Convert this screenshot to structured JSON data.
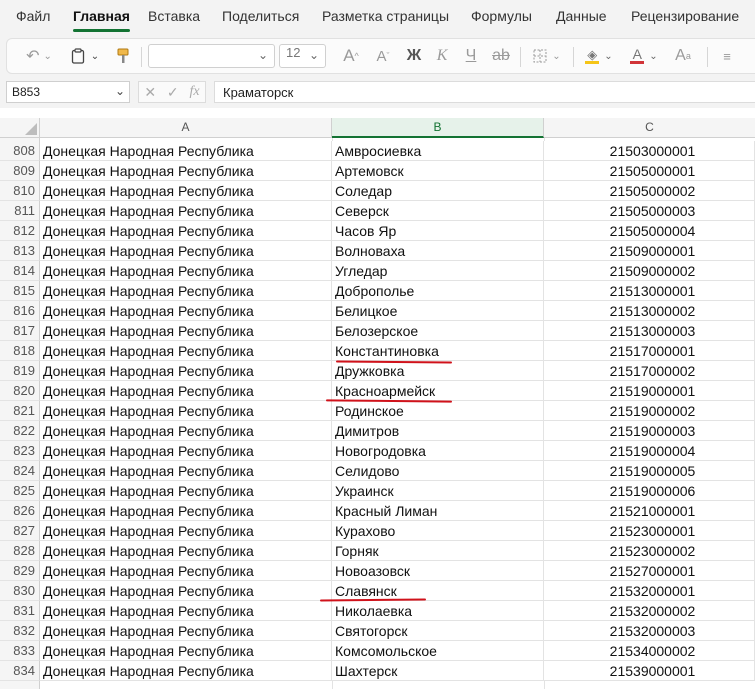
{
  "menu": {
    "tabs": [
      "Файл",
      "Главная",
      "Вставка",
      "Поделиться",
      "Разметка страницы",
      "Формулы",
      "Данные",
      "Рецензирование"
    ],
    "active_index": 1
  },
  "ribbon": {
    "font_name": "",
    "font_size": "12",
    "icons": [
      "undo-icon",
      "clipboard-icon",
      "format-painter-icon",
      "increase-font-icon",
      "decrease-font-icon",
      "bold-icon",
      "italic-icon",
      "underline-icon",
      "strikethrough-icon",
      "borders-icon",
      "fill-color-icon",
      "font-color-icon",
      "more-font-icon"
    ],
    "fill_color": "#f5c518",
    "font_color": "#d13438"
  },
  "formula_bar": {
    "name_box": "B853",
    "formula": "Краматорск"
  },
  "columns": [
    {
      "label": "A",
      "selected": false
    },
    {
      "label": "B",
      "selected": true
    },
    {
      "label": "C",
      "selected": false
    }
  ],
  "rows": [
    {
      "n": "808",
      "a": "Донецкая Народная Республика",
      "b": "Амвросиевка",
      "c": "21503000001"
    },
    {
      "n": "809",
      "a": "Донецкая Народная Республика",
      "b": "Артемовск",
      "c": "21505000001"
    },
    {
      "n": "810",
      "a": "Донецкая Народная Республика",
      "b": "Соледар",
      "c": "21505000002"
    },
    {
      "n": "811",
      "a": "Донецкая Народная Республика",
      "b": "Северск",
      "c": "21505000003"
    },
    {
      "n": "812",
      "a": "Донецкая Народная Республика",
      "b": "Часов Яр",
      "c": "21505000004"
    },
    {
      "n": "813",
      "a": "Донецкая Народная Республика",
      "b": "Волноваха",
      "c": "21509000001"
    },
    {
      "n": "814",
      "a": "Донецкая Народная Республика",
      "b": "Угледар",
      "c": "21509000002"
    },
    {
      "n": "815",
      "a": "Донецкая Народная Республика",
      "b": "Доброполье",
      "c": "21513000001"
    },
    {
      "n": "816",
      "a": "Донецкая Народная Республика",
      "b": "Белицкое",
      "c": "21513000002"
    },
    {
      "n": "817",
      "a": "Донецкая Народная Республика",
      "b": "Белозерское",
      "c": "21513000003"
    },
    {
      "n": "818",
      "a": "Донецкая Народная Республика",
      "b": "Константиновка",
      "c": "21517000001"
    },
    {
      "n": "819",
      "a": "Донецкая Народная Республика",
      "b": "Дружковка",
      "c": "21517000002"
    },
    {
      "n": "820",
      "a": "Донецкая Народная Республика",
      "b": "Красноармейск",
      "c": "21519000001"
    },
    {
      "n": "821",
      "a": "Донецкая Народная Республика",
      "b": "Родинское",
      "c": "21519000002"
    },
    {
      "n": "822",
      "a": "Донецкая Народная Республика",
      "b": "Димитров",
      "c": "21519000003"
    },
    {
      "n": "823",
      "a": "Донецкая Народная Республика",
      "b": "Новогродовка",
      "c": "21519000004"
    },
    {
      "n": "824",
      "a": "Донецкая Народная Республика",
      "b": "Селидово",
      "c": "21519000005"
    },
    {
      "n": "825",
      "a": "Донецкая Народная Республика",
      "b": "Украинск",
      "c": "21519000006"
    },
    {
      "n": "826",
      "a": "Донецкая Народная Республика",
      "b": "Красный Лиман",
      "c": "21521000001"
    },
    {
      "n": "827",
      "a": "Донецкая Народная Республика",
      "b": "Курахово",
      "c": "21523000001"
    },
    {
      "n": "828",
      "a": "Донецкая Народная Республика",
      "b": "Горняк",
      "c": "21523000002"
    },
    {
      "n": "829",
      "a": "Донецкая Народная Республика",
      "b": "Новоазовск",
      "c": "21527000001"
    },
    {
      "n": "830",
      "a": "Донецкая Народная Республика",
      "b": "Славянск",
      "c": "21532000001"
    },
    {
      "n": "831",
      "a": "Донецкая Народная Республика",
      "b": "Николаевка",
      "c": "21532000002"
    },
    {
      "n": "832",
      "a": "Донецкая Народная Республика",
      "b": "Святогорск",
      "c": "21532000003"
    },
    {
      "n": "833",
      "a": "Донецкая Народная Республика",
      "b": "Комсомольское",
      "c": "21534000002"
    },
    {
      "n": "834",
      "a": "Донецкая Народная Республика",
      "b": "Шахтерск",
      "c": "21539000001"
    }
  ],
  "annotations": {
    "underline_color": "#d0121b",
    "underlined_rows": [
      "818",
      "820",
      "830"
    ]
  }
}
